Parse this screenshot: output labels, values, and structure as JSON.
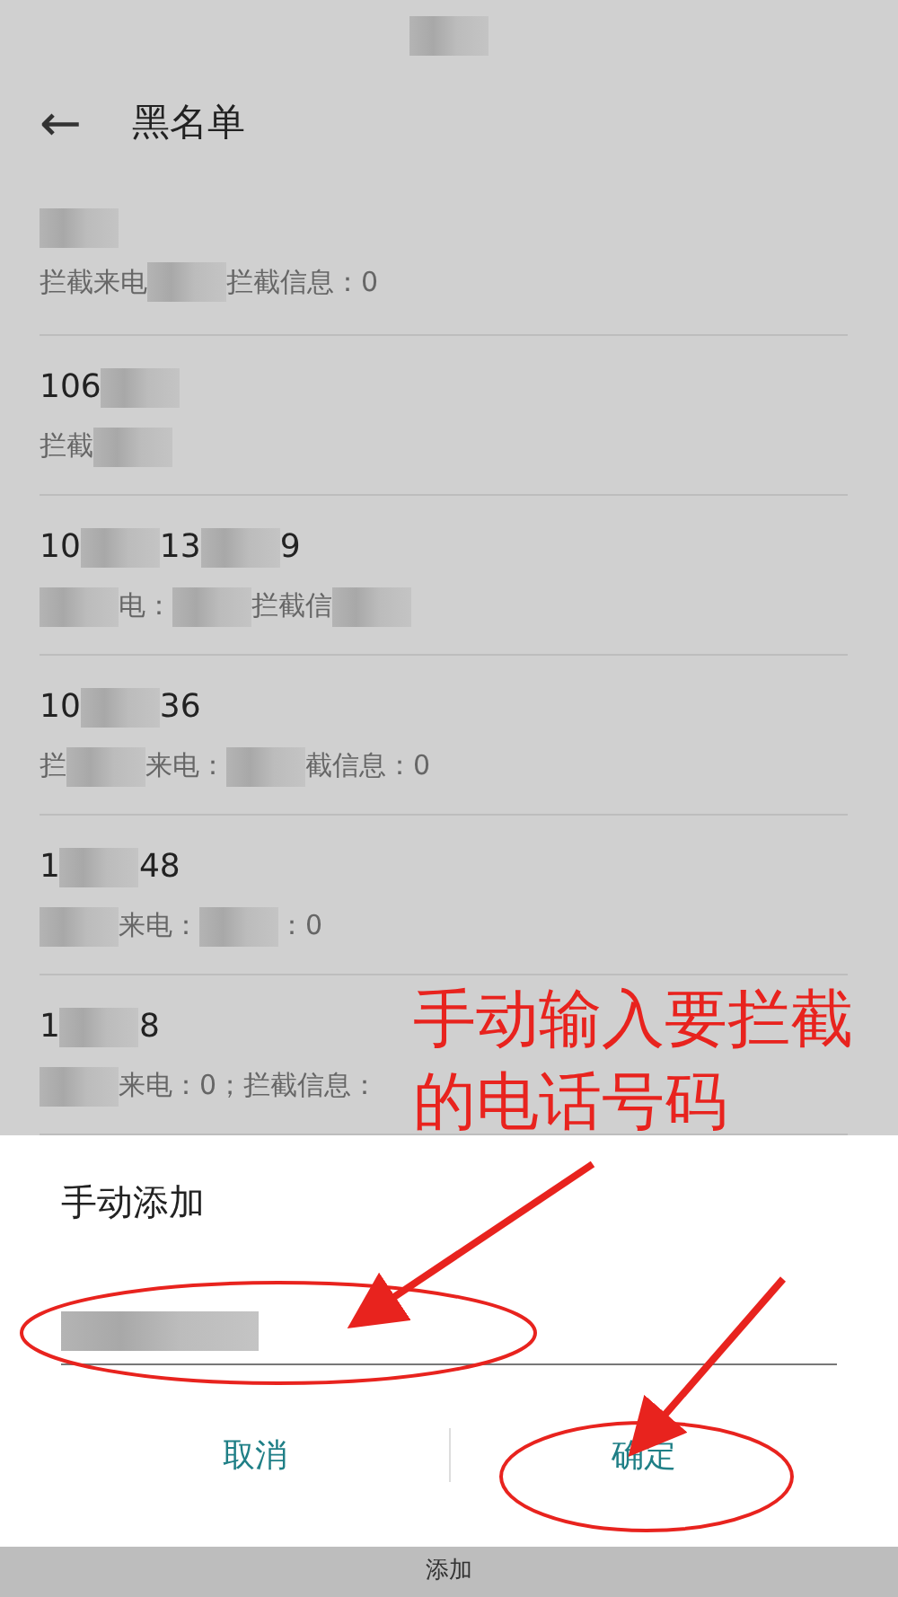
{
  "header": {
    "back": "←",
    "title": "黑名单"
  },
  "list": [
    {
      "title": [
        {
          "kind": "redacted"
        }
      ],
      "subtitle": [
        {
          "kind": "text",
          "text": "拦截来电"
        },
        {
          "kind": "redacted"
        },
        {
          "kind": "text",
          "text": "拦截信息：0"
        }
      ]
    },
    {
      "title": [
        {
          "kind": "text",
          "text": "106"
        },
        {
          "kind": "redacted"
        }
      ],
      "subtitle": [
        {
          "kind": "text",
          "text": "拦截"
        },
        {
          "kind": "redacted"
        }
      ]
    },
    {
      "title": [
        {
          "kind": "text",
          "text": "10"
        },
        {
          "kind": "redacted"
        },
        {
          "kind": "text",
          "text": "13"
        },
        {
          "kind": "redacted"
        },
        {
          "kind": "text",
          "text": "9"
        }
      ],
      "subtitle": [
        {
          "kind": "redacted"
        },
        {
          "kind": "text",
          "text": "电："
        },
        {
          "kind": "redacted"
        },
        {
          "kind": "text",
          "text": "拦截信"
        },
        {
          "kind": "redacted"
        }
      ]
    },
    {
      "title": [
        {
          "kind": "text",
          "text": "10"
        },
        {
          "kind": "redacted"
        },
        {
          "kind": "text",
          "text": "36"
        }
      ],
      "subtitle": [
        {
          "kind": "text",
          "text": "拦"
        },
        {
          "kind": "redacted"
        },
        {
          "kind": "text",
          "text": "来电："
        },
        {
          "kind": "redacted"
        },
        {
          "kind": "text",
          "text": "截信息：0"
        }
      ]
    },
    {
      "title": [
        {
          "kind": "text",
          "text": "1"
        },
        {
          "kind": "redacted"
        },
        {
          "kind": "text",
          "text": "48"
        }
      ],
      "subtitle": [
        {
          "kind": "redacted"
        },
        {
          "kind": "text",
          "text": "来电："
        },
        {
          "kind": "redacted"
        },
        {
          "kind": "text",
          "text": "：0"
        }
      ]
    },
    {
      "title": [
        {
          "kind": "text",
          "text": "1"
        },
        {
          "kind": "redacted"
        },
        {
          "kind": "text",
          "text": "8"
        }
      ],
      "subtitle": [
        {
          "kind": "redacted"
        },
        {
          "kind": "text",
          "text": "来电：0；拦截信息："
        }
      ]
    }
  ],
  "dialog": {
    "title": "手动添加",
    "buttons": [
      {
        "label": "取消"
      },
      {
        "label": "确定"
      }
    ]
  },
  "bottom_bar": {
    "label": "添加"
  },
  "annotation": {
    "lines": [
      "手动输入要拦截",
      "的电话号码"
    ]
  }
}
